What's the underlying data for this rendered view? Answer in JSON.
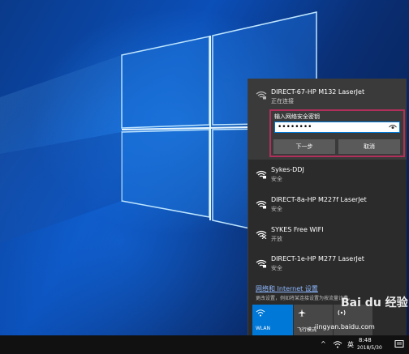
{
  "expanded_network": {
    "name": "DIRECT-67-HP M132 LaserJet",
    "status": "正在连接",
    "key_label": "输入网络安全密钥",
    "key_value": "••••••••",
    "next_label": "下一步",
    "cancel_label": "取消"
  },
  "networks": [
    {
      "name": "Sykes-DDJ",
      "status": "安全",
      "icon": "wifi-secured-icon"
    },
    {
      "name": "DIRECT-8a-HP M227f LaserJet",
      "status": "安全",
      "icon": "wifi-secured-icon"
    },
    {
      "name": "SYKES Free WIFI",
      "status": "开放",
      "icon": "wifi-open-icon"
    },
    {
      "name": "DIRECT-1e-HP M277 LaserJet",
      "status": "安全",
      "icon": "wifi-secured-icon"
    }
  ],
  "settings": {
    "link_label": "网络和 Internet 设置",
    "description": "更改设置，例如将某连接设置为按流量计费。"
  },
  "quick_actions": {
    "wlan_label": "WLAN",
    "airplane_label": "飞行模式",
    "hotspot_label": ""
  },
  "taskbar": {
    "tray_up": "^",
    "ime": "英",
    "time": "8:48",
    "date": "2018/5/30"
  },
  "watermark": {
    "logo_text": "Bai du 经验",
    "url": "jingyan.baidu.com"
  },
  "colors": {
    "accent": "#0078d7",
    "highlight_border": "#b0305a",
    "flyout_bg": "#2b2b2b"
  }
}
